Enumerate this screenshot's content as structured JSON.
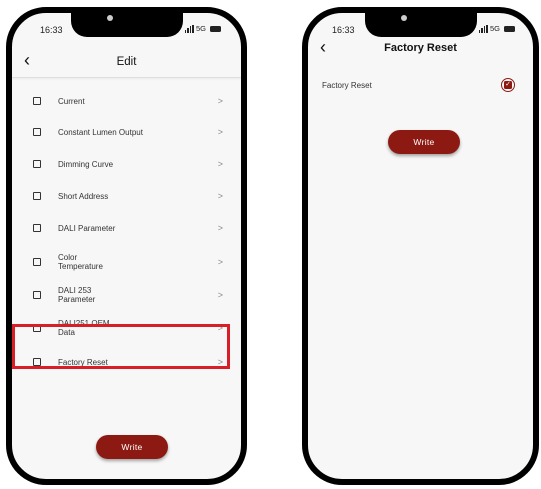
{
  "left_screen": {
    "status": {
      "time": "16:33",
      "network": "5G"
    },
    "nav": {
      "back_icon": "‹",
      "title": "Edit"
    },
    "items": [
      {
        "label": "Current"
      },
      {
        "label": "Constant Lumen Output"
      },
      {
        "label": "Dimming Curve"
      },
      {
        "label": "Short Address"
      },
      {
        "label": "DALI Parameter"
      },
      {
        "label": "Color Temperature"
      },
      {
        "label": "DALI 253 Parameter"
      },
      {
        "label": "DALI251 OEM Data"
      },
      {
        "label": "Factory Reset"
      }
    ],
    "write_label": "Write"
  },
  "right_screen": {
    "status": {
      "time": "16:33",
      "network": "5G"
    },
    "nav": {
      "back_icon": "‹",
      "title": "Factory Reset"
    },
    "row": {
      "label": "Factory Reset",
      "checked": true
    },
    "write_label": "Write"
  },
  "colors": {
    "accent": "#8d1a12",
    "highlight": "#d81f28"
  }
}
